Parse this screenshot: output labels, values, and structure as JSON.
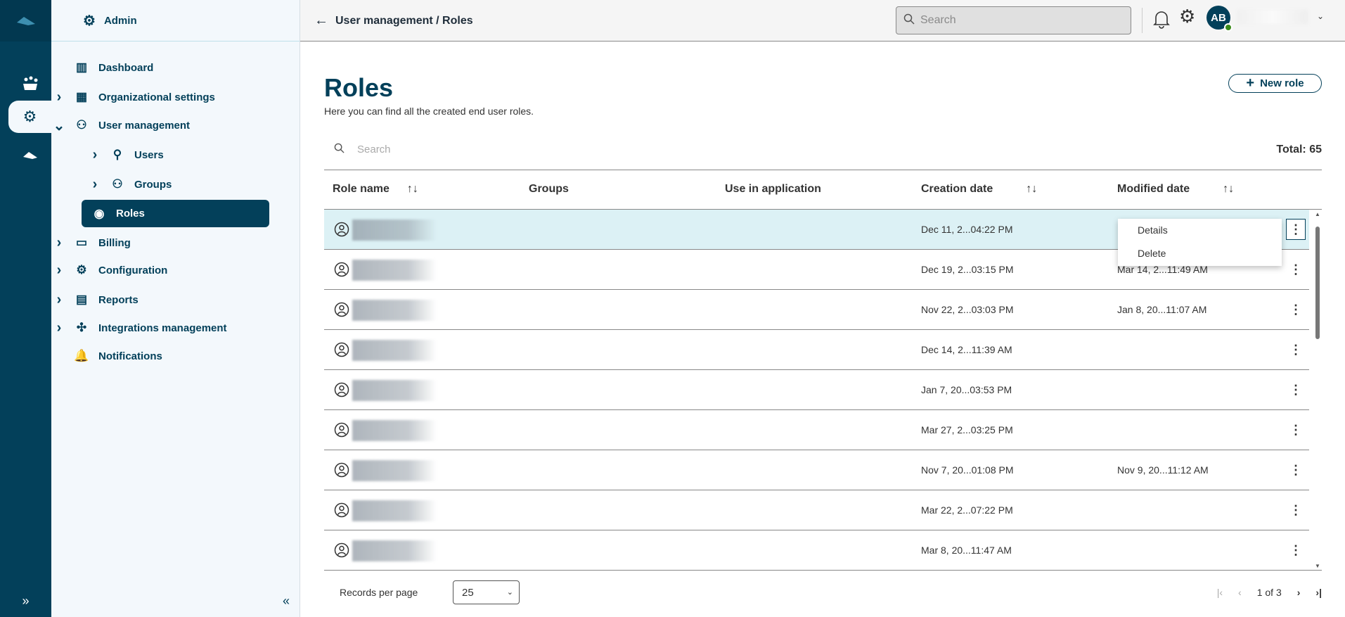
{
  "nav": {
    "header": "Admin",
    "items": [
      {
        "label": "Dashboard",
        "chev": false
      },
      {
        "label": "Organizational settings",
        "chev": true
      },
      {
        "label": "User management",
        "chev": "open"
      },
      {
        "label": "Users",
        "chev": true,
        "sub": true
      },
      {
        "label": "Groups",
        "chev": true,
        "sub": true
      },
      {
        "label": "Roles",
        "active": true,
        "sub": true
      },
      {
        "label": "Billing",
        "chev": true
      },
      {
        "label": "Configuration",
        "chev": true
      },
      {
        "label": "Reports",
        "chev": true
      },
      {
        "label": "Integrations management",
        "chev": true
      },
      {
        "label": "Notifications",
        "chev": false
      }
    ]
  },
  "topbar": {
    "breadcrumb": "User management / Roles",
    "search_placeholder": "Search",
    "avatar_initials": "AB"
  },
  "page": {
    "title": "Roles",
    "subtitle": "Here you can find all the created end user roles.",
    "new_role": "New role",
    "search_placeholder": "Search",
    "total": "Total: 65"
  },
  "table": {
    "columns": [
      "Role name",
      "Groups",
      "Use in application",
      "Creation date",
      "Modified date"
    ],
    "rows": [
      {
        "created": "Dec 11, 2...04:22 PM",
        "modified": ""
      },
      {
        "created": "Dec 19, 2...03:15 PM",
        "modified": "Mar 14, 2...11:49 AM"
      },
      {
        "created": "Nov 22, 2...03:03 PM",
        "modified": "Jan 8, 20...11:07 AM"
      },
      {
        "created": "Dec 14, 2...11:39 AM",
        "modified": ""
      },
      {
        "created": "Jan 7, 20...03:53 PM",
        "modified": ""
      },
      {
        "created": "Mar 27, 2...03:25 PM",
        "modified": ""
      },
      {
        "created": "Nov 7, 20...01:08 PM",
        "modified": "Nov 9, 20...11:12 AM"
      },
      {
        "created": "Mar 22, 2...07:22 PM",
        "modified": ""
      },
      {
        "created": "Mar 8, 20...11:47 AM",
        "modified": ""
      }
    ]
  },
  "menu": {
    "items": [
      "Details",
      "Delete"
    ]
  },
  "footer": {
    "records_per_page": "Records per page",
    "page_size": "25",
    "page_info": "1 of 3"
  }
}
